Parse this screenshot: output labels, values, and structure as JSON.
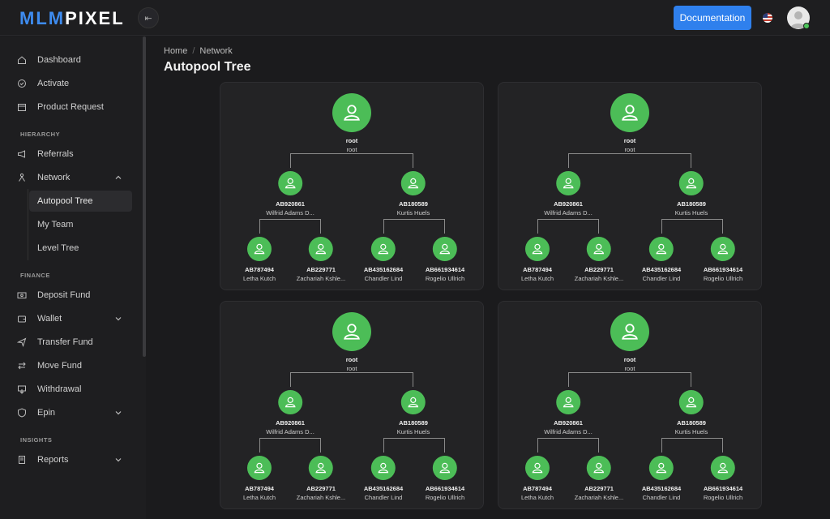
{
  "brand": {
    "logo_part1": "MLM",
    "logo_part2": "PIXEL"
  },
  "header": {
    "documentation_label": "Documentation",
    "collapse_icon": "⇤"
  },
  "sidebar": {
    "dashboard": "Dashboard",
    "activate": "Activate",
    "product_request": "Product Request",
    "hierarchy_label": "HIERARCHY",
    "referrals": "Referrals",
    "network": "Network",
    "network_sub": [
      "Autopool Tree",
      "My Team",
      "Level Tree"
    ],
    "finance_label": "FINANCE",
    "deposit_fund": "Deposit Fund",
    "wallet": "Wallet",
    "transfer_fund": "Transfer Fund",
    "move_fund": "Move Fund",
    "withdrawal": "Withdrawal",
    "epin": "Epin",
    "insights_label": "INSIGHTS",
    "reports": "Reports"
  },
  "breadcrumb": {
    "home": "Home",
    "current": "Network"
  },
  "page_title": "Autopool Tree",
  "tree": {
    "root": {
      "id": "root",
      "name": "root"
    },
    "level1": [
      {
        "id": "AB920861",
        "name": "Wilfrid Adams D..."
      },
      {
        "id": "AB180589",
        "name": "Kurtis Huels"
      }
    ],
    "level2": [
      {
        "id": "AB787494",
        "name": "Letha Kutch"
      },
      {
        "id": "AB229771",
        "name": "Zachariah Kshle..."
      },
      {
        "id": "AB435162684",
        "name": "Chandler Lind"
      },
      {
        "id": "AB661934614",
        "name": "Rogelio Ullrich"
      }
    ]
  },
  "colors": {
    "accent": "#2f80ed",
    "node": "#4cbd57",
    "background": "#1b1b1d",
    "card": "#232325"
  }
}
